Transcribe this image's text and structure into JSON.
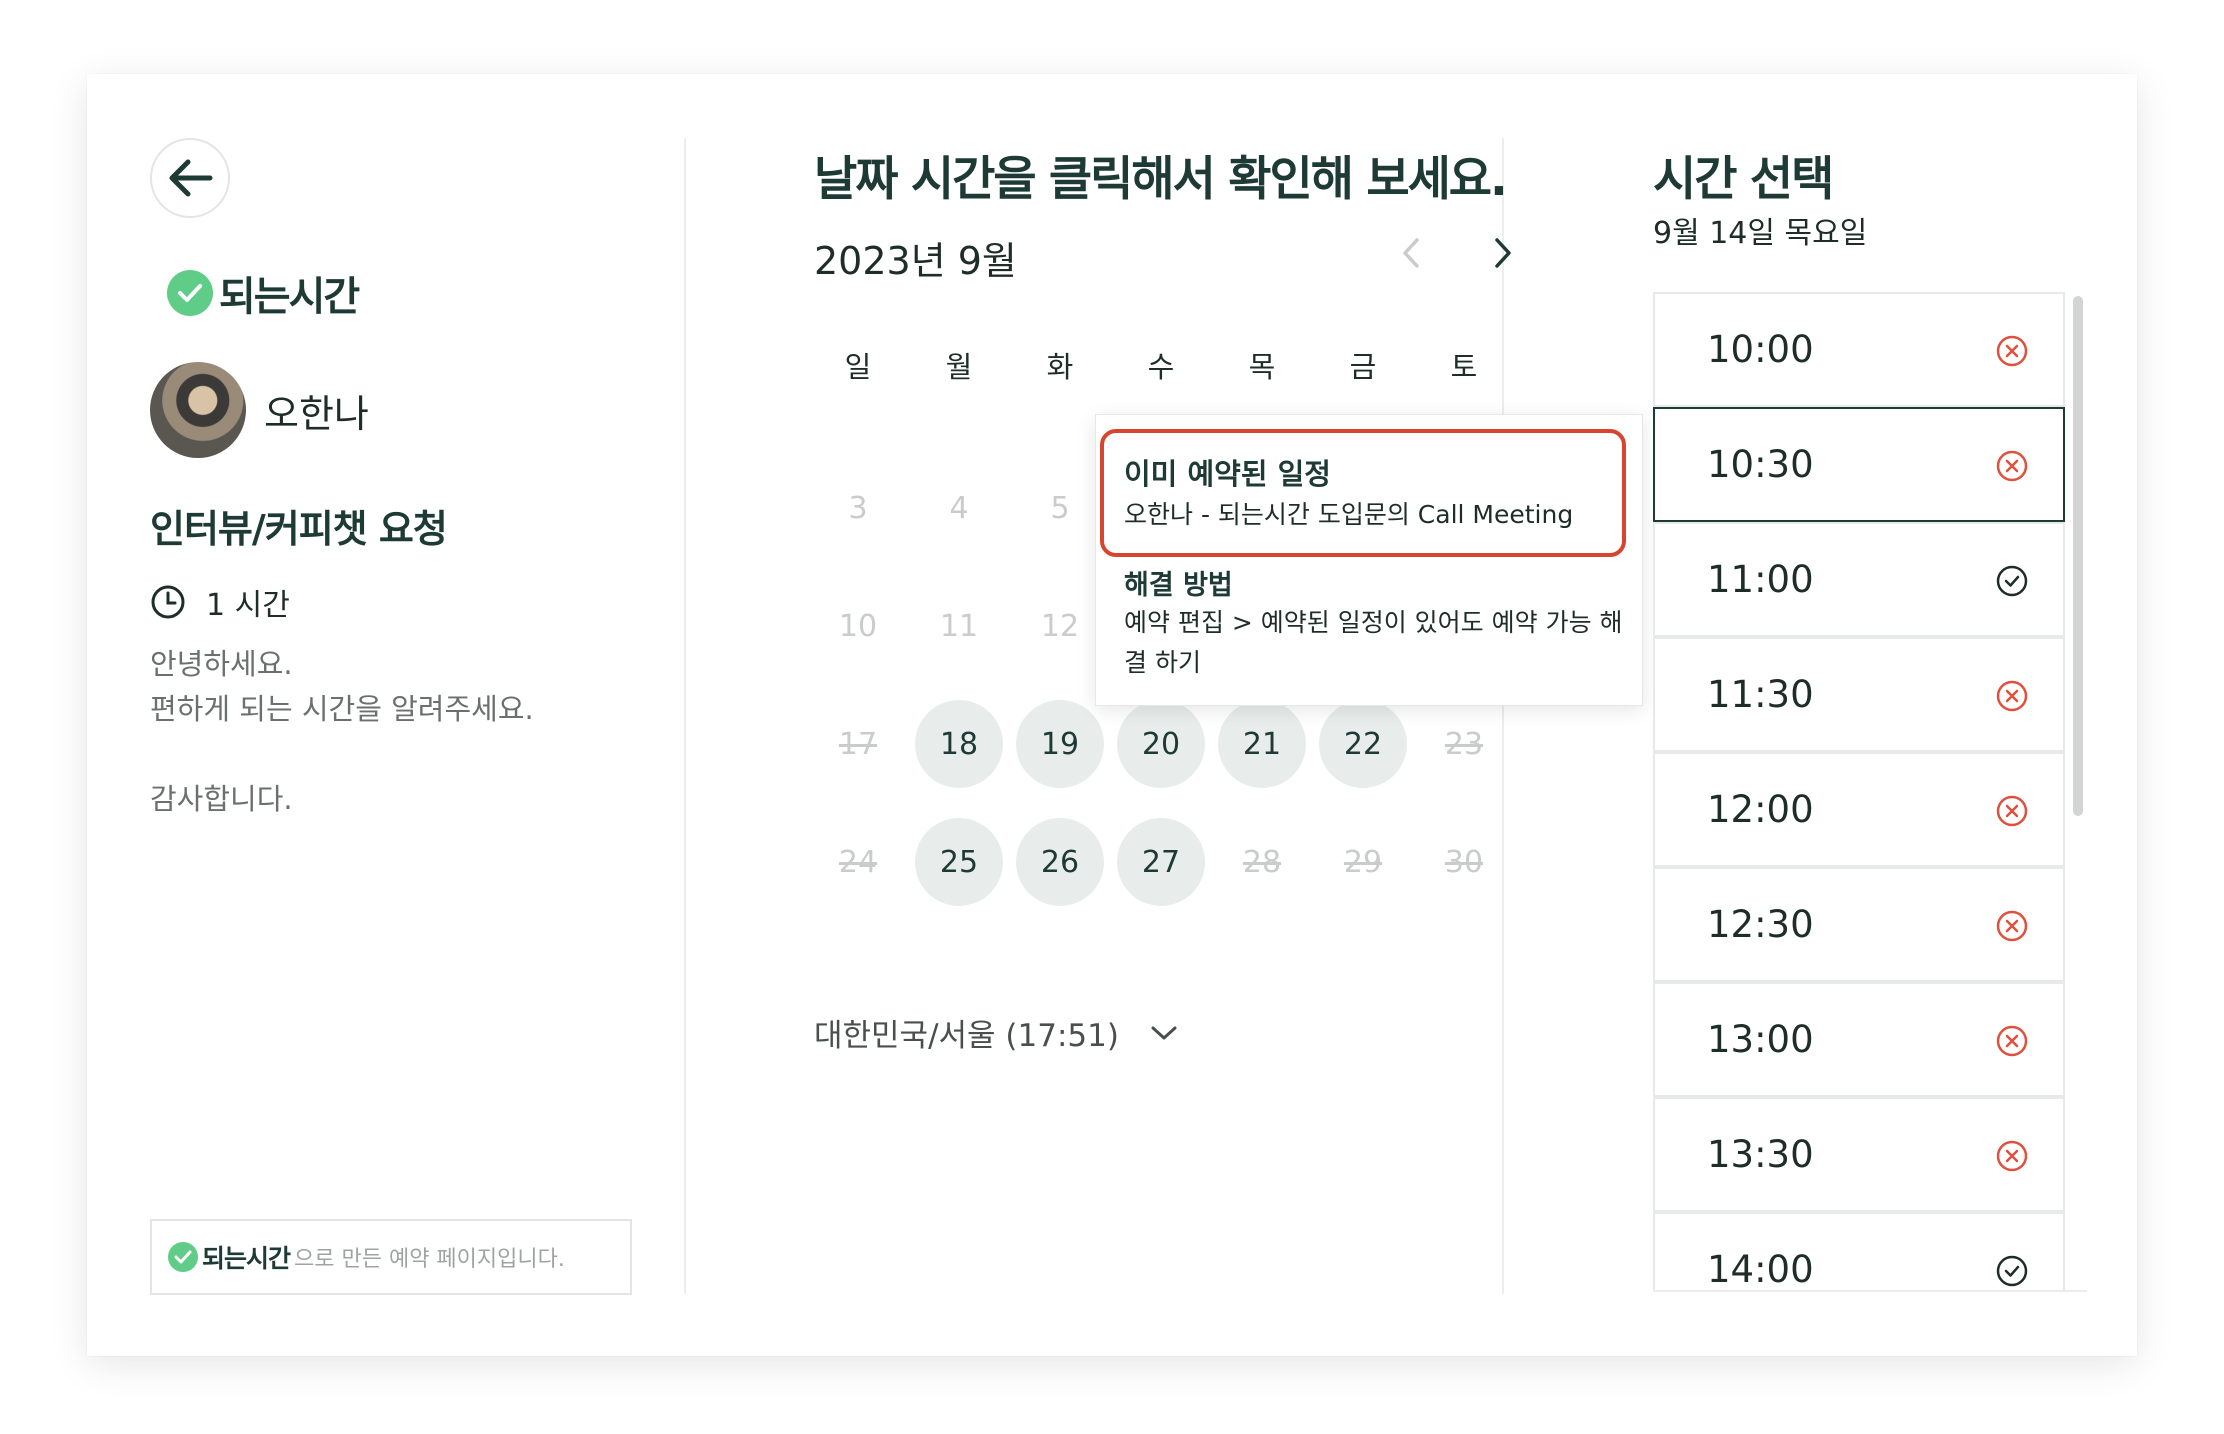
{
  "brand": {
    "name": "되는시간",
    "accent": "#5fcd88",
    "dark": "#1e3a34"
  },
  "host": {
    "name": "오한나"
  },
  "event": {
    "title": "인터뷰/커피챗 요청",
    "duration": "1 시간",
    "description": "안녕하세요.\n편하게 되는 시간을  알려주세요.\n\n감사합니다."
  },
  "footer": {
    "brand": "되는시간",
    "text": "으로 만든 예약 페이지입니다."
  },
  "calendar": {
    "title": "날짜 시간을 클릭해서 확인해 보세요.",
    "month": "2023년 9월",
    "weekdays": [
      "일",
      "월",
      "화",
      "수",
      "목",
      "금",
      "토"
    ],
    "row2": [
      "3",
      "4",
      "5"
    ],
    "row3": [
      "10",
      "11",
      "12"
    ],
    "row4": [
      "17",
      "18",
      "19",
      "20",
      "21",
      "22",
      "23"
    ],
    "row5": [
      "24",
      "25",
      "26",
      "27",
      "28",
      "29",
      "30"
    ],
    "timezone": "대한민국/서울 (17:51)"
  },
  "popup": {
    "title": "이미 예약된 일정",
    "subtitle": "오한나 - 되는시간 도입문의 Call Meeting",
    "fix_title": "해결 방법",
    "fix_text": "예약 편집 > 예약된 일정이 있어도 예약 가능 해결 하기",
    "highlight_color": "#d8452f"
  },
  "times": {
    "title": "시간 선택",
    "date": "9월 14일 목요일",
    "slots": [
      {
        "time": "10:00",
        "status": "unavailable"
      },
      {
        "time": "10:30",
        "status": "unavailable"
      },
      {
        "time": "11:00",
        "status": "available"
      },
      {
        "time": "11:30",
        "status": "unavailable"
      },
      {
        "time": "12:00",
        "status": "unavailable"
      },
      {
        "time": "12:30",
        "status": "unavailable"
      },
      {
        "time": "13:00",
        "status": "unavailable"
      },
      {
        "time": "13:30",
        "status": "unavailable"
      },
      {
        "time": "14:00",
        "status": "available"
      }
    ]
  }
}
